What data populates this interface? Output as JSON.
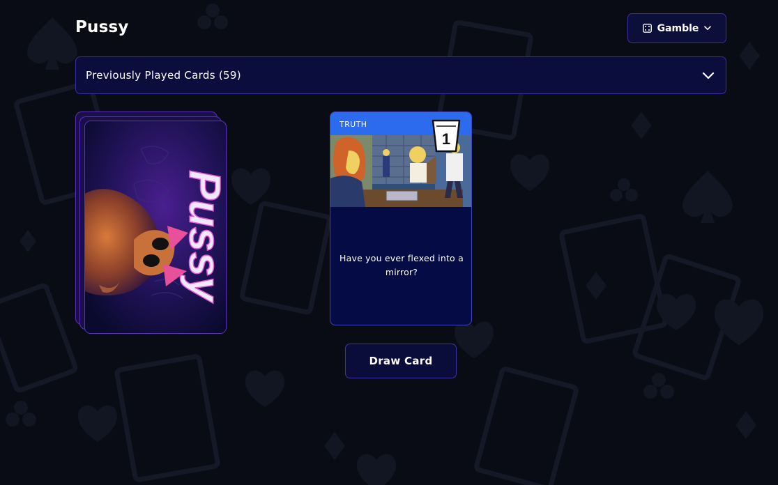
{
  "header": {
    "title": "Pussy",
    "mode_button": {
      "label": "Gamble",
      "icon": "dice-icon",
      "caret": "chevron-down-icon"
    }
  },
  "history": {
    "label": "Previously Played Cards (59)",
    "icon": "chevron-down-icon"
  },
  "deck": {
    "cover_text": "Pussy"
  },
  "current_card": {
    "type": "TRUTH",
    "shots": "1",
    "question": "Have you ever flexed into a mirror?",
    "header_color": "#2d6bee"
  },
  "actions": {
    "draw_label": "Draw Card"
  },
  "colors": {
    "background": "#0a0c15",
    "panel": "#0b0d3d",
    "border": "#3b2f9a",
    "accent": "#2d6bee"
  }
}
